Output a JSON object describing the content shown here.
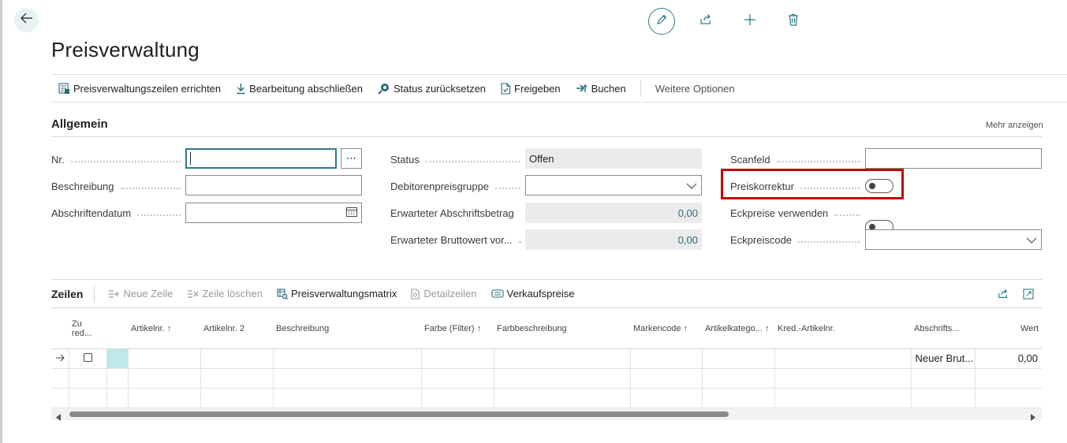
{
  "page": {
    "title": "Preisverwaltung"
  },
  "top_actions": {
    "back": "back-arrow-icon",
    "edit": "pencil-icon",
    "share": "share-icon",
    "new": "plus-icon",
    "delete": "trash-icon"
  },
  "actions": [
    {
      "label": "Preisverwaltungszeilen errichten",
      "icon": "calculate-icon"
    },
    {
      "label": "Bearbeitung abschließen",
      "icon": "download-arrow-icon"
    },
    {
      "label": "Status zurücksetzen",
      "icon": "reset-status-icon"
    },
    {
      "label": "Freigeben",
      "icon": "release-document-icon"
    },
    {
      "label": "Buchen",
      "icon": "post-icon"
    }
  ],
  "more_options": "Weitere Optionen",
  "general": {
    "title": "Allgemein",
    "show_more": "Mehr anzeigen",
    "fields": {
      "nr": {
        "label": "Nr.",
        "value": "",
        "lookup": "⋯"
      },
      "beschreibung": {
        "label": "Beschreibung",
        "value": ""
      },
      "abschriftendatum": {
        "label": "Abschriftendatum",
        "value": ""
      },
      "status": {
        "label": "Status",
        "value": "Offen"
      },
      "debitorenpreisgruppe": {
        "label": "Debitorenpreisgruppe",
        "value": ""
      },
      "erwarteter_abschriftsbetrag": {
        "label": "Erwarteter Abschriftsbetrag",
        "value": "0,00"
      },
      "erwarteter_bruttowert": {
        "label": "Erwarteter Bruttowert vor...",
        "value": "0,00"
      },
      "scanfeld": {
        "label": "Scanfeld",
        "value": ""
      },
      "preiskorrektur": {
        "label": "Preiskorrektur",
        "value": false
      },
      "eckpreise_verwenden": {
        "label": "Eckpreise verwenden",
        "value": false
      },
      "eckpreiscode": {
        "label": "Eckpreiscode",
        "value": ""
      }
    }
  },
  "lines": {
    "title": "Zeilen",
    "actions": [
      {
        "label": "Neue Zeile",
        "enabled": false
      },
      {
        "label": "Zeile löschen",
        "enabled": false
      },
      {
        "label": "Preisverwaltungsmatrix",
        "enabled": true
      },
      {
        "label": "Detailzeilen",
        "enabled": false
      },
      {
        "label": "Verkaufspreise",
        "enabled": true
      }
    ],
    "columns": [
      "Zu red...",
      "Artikelnr. ↑",
      "Artikelnr. 2",
      "Beschreibung",
      "Farbe (Filter) ↑",
      "Farbbeschreibung",
      "Markencode ↑",
      "Artikelkatego... ↑",
      "Kred.-Artikelnr.",
      "Abschrifts...",
      "Wert"
    ],
    "rows": [
      {
        "abschrifts": "Neuer Brut...",
        "wert": "0,00"
      }
    ]
  }
}
